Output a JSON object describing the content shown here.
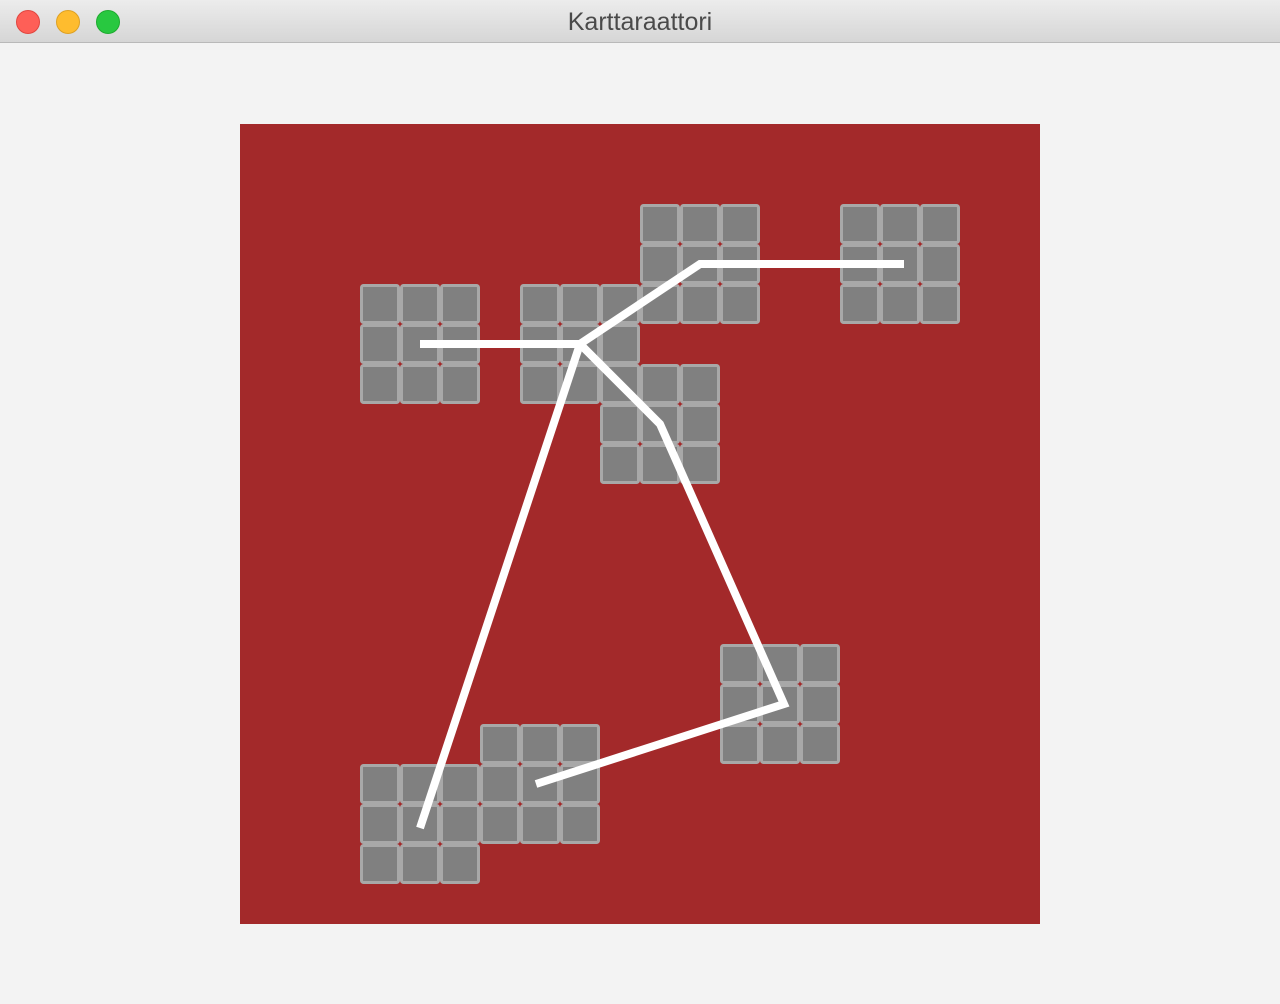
{
  "window": {
    "title": "Karttaraattori"
  },
  "colors": {
    "map_background": "#a3292a",
    "tile_fill": "#808080",
    "tile_border": "#a8a8a8",
    "path_stroke": "#ffffff"
  },
  "map": {
    "grid_size": 20,
    "rooms": [
      {
        "col": 3,
        "row": 4
      },
      {
        "col": 7,
        "row": 4
      },
      {
        "col": 10,
        "row": 2
      },
      {
        "col": 15,
        "row": 2
      },
      {
        "col": 9,
        "row": 6
      },
      {
        "col": 12,
        "row": 13
      },
      {
        "col": 3,
        "row": 16
      },
      {
        "col": 6,
        "row": 15
      }
    ],
    "path": [
      [
        4.5,
        5.5
      ],
      [
        8.5,
        5.5
      ],
      [
        11.5,
        3.5
      ],
      [
        16.6,
        3.5
      ]
    ],
    "path2": [
      [
        8.5,
        5.5
      ],
      [
        10.5,
        7.5
      ],
      [
        13.6,
        14.5
      ],
      [
        7.4,
        16.5
      ]
    ],
    "path3": [
      [
        8.5,
        5.5
      ],
      [
        4.5,
        17.6
      ]
    ]
  }
}
